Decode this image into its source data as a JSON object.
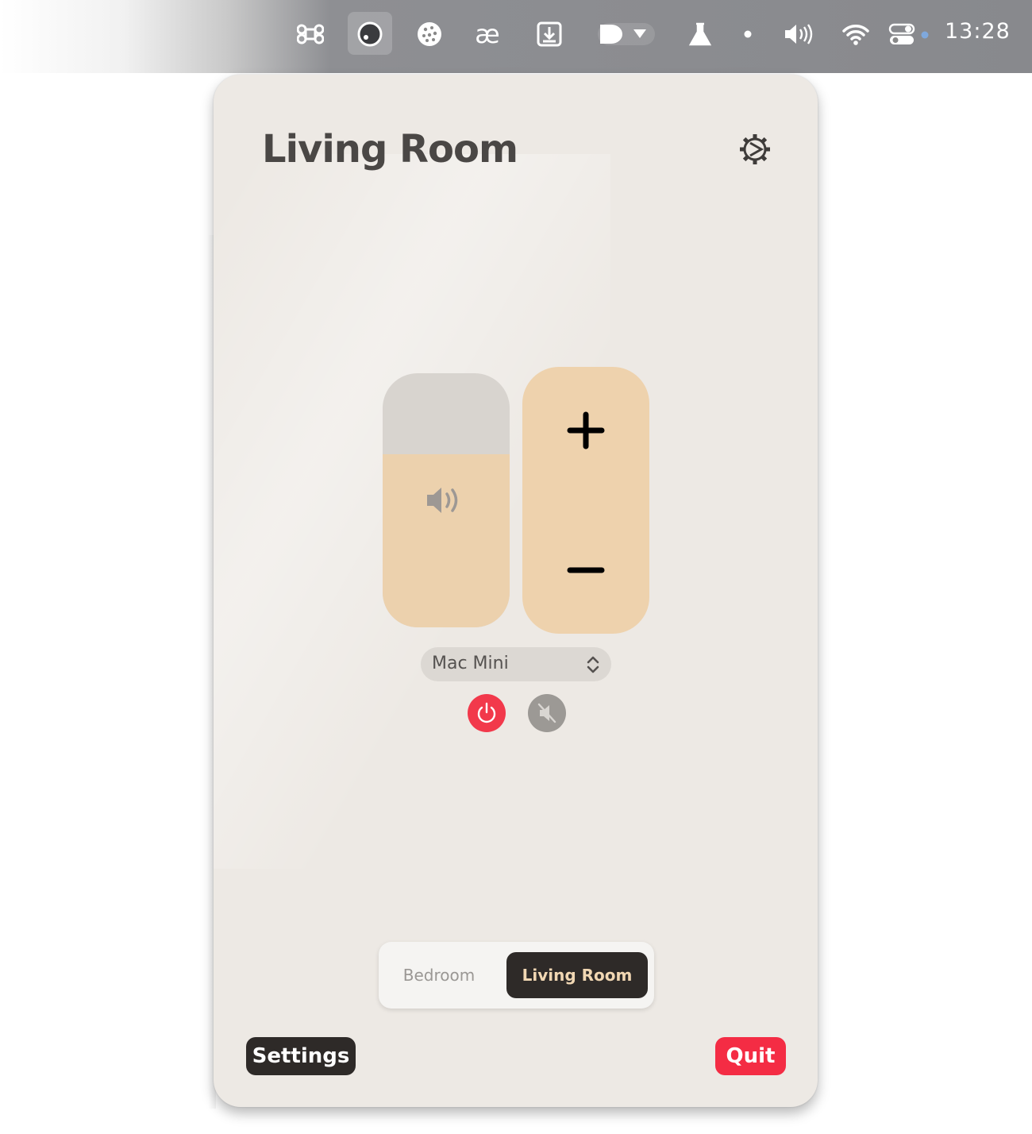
{
  "menubar": {
    "clock": "13:28",
    "items": [
      {
        "icon": "command-icon"
      },
      {
        "icon": "knob-icon",
        "active": true
      },
      {
        "icon": "cookie-icon"
      },
      {
        "icon": "ae-ligature-icon",
        "glyph": "æ"
      },
      {
        "icon": "download-box-icon"
      },
      {
        "icon": "shape-dropdown-icon"
      },
      {
        "icon": "flask-icon"
      },
      {
        "icon": "dot-icon"
      },
      {
        "icon": "volume-icon"
      },
      {
        "icon": "wifi-icon"
      },
      {
        "icon": "control-center-icon"
      }
    ]
  },
  "popover": {
    "title": "Living Room",
    "settings_icon": "gear-icon",
    "volume": {
      "level": 0.68,
      "icon": "speaker-icon"
    },
    "stepper": {
      "plus": "+",
      "minus": "−"
    },
    "device": {
      "selected": "Mac Mini"
    },
    "power_icon": "power-icon",
    "mute_icon": "mute-icon",
    "rooms": {
      "items": [
        "Bedroom",
        "Living Room"
      ],
      "selected": "Living Room"
    },
    "footer": {
      "settings_label": "Settings",
      "quit_label": "Quit"
    }
  },
  "colors": {
    "panel": "#ede9e4",
    "accent_peach": "#eed2ad",
    "dark": "#2e2a28",
    "red": "#f42c44"
  }
}
